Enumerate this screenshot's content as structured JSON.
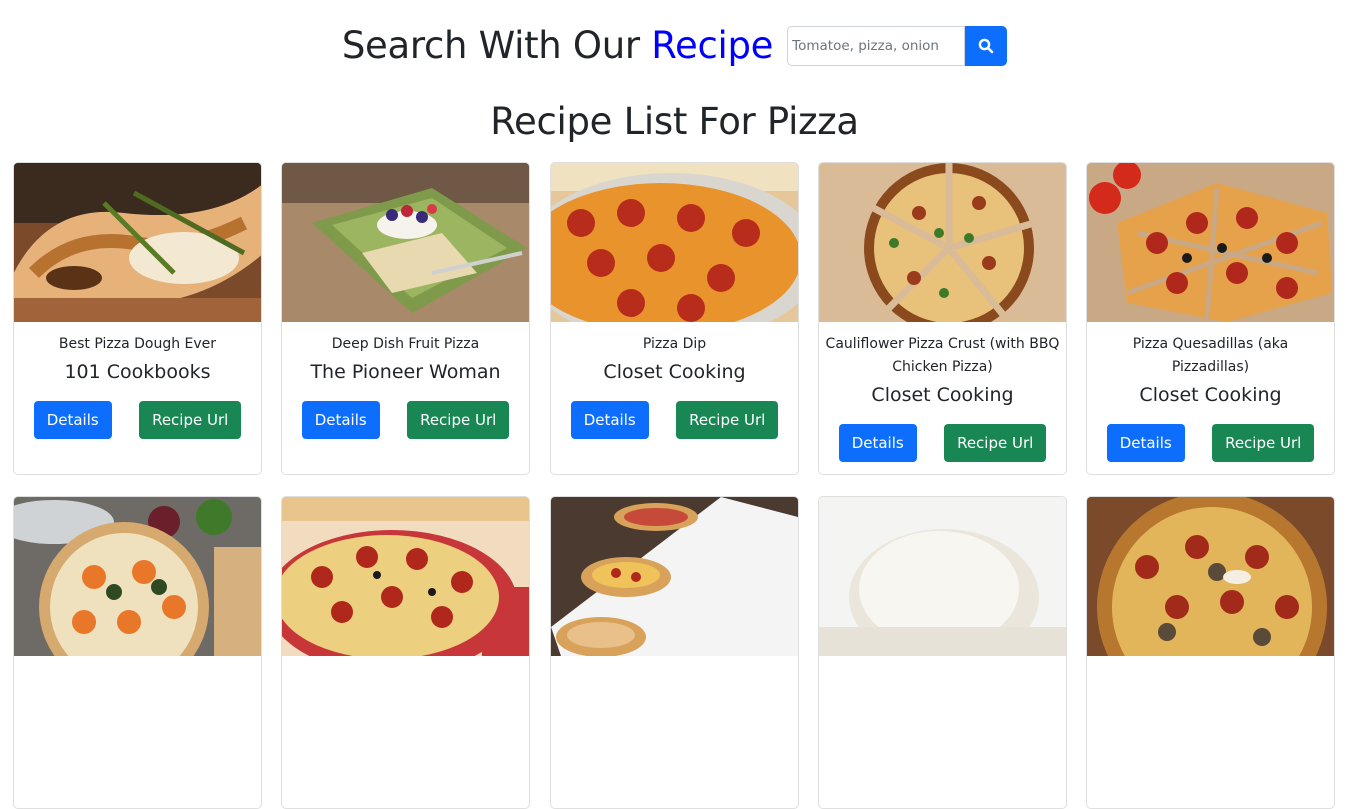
{
  "header": {
    "title_prefix": "Search With Our",
    "title_accent": "Recipe"
  },
  "search": {
    "placeholder": "Tomatoe, pizza, onion",
    "value": ""
  },
  "list_heading": "Recipe List For Pizza",
  "buttons": {
    "details": "Details",
    "recipe_url": "Recipe Url"
  },
  "recipes": [
    {
      "title": "Best Pizza Dough Ever",
      "publisher": "101 Cookbooks"
    },
    {
      "title": "Deep Dish Fruit Pizza",
      "publisher": "The Pioneer Woman"
    },
    {
      "title": "Pizza Dip",
      "publisher": "Closet Cooking"
    },
    {
      "title": "Cauliflower Pizza Crust (with BBQ Chicken Pizza)",
      "publisher": "Closet Cooking"
    },
    {
      "title": "Pizza Quesadillas (aka Pizzadillas)",
      "publisher": "Closet Cooking"
    }
  ],
  "colors": {
    "accent": "#0000ff",
    "primary": "#0d6efd",
    "success": "#198754"
  }
}
